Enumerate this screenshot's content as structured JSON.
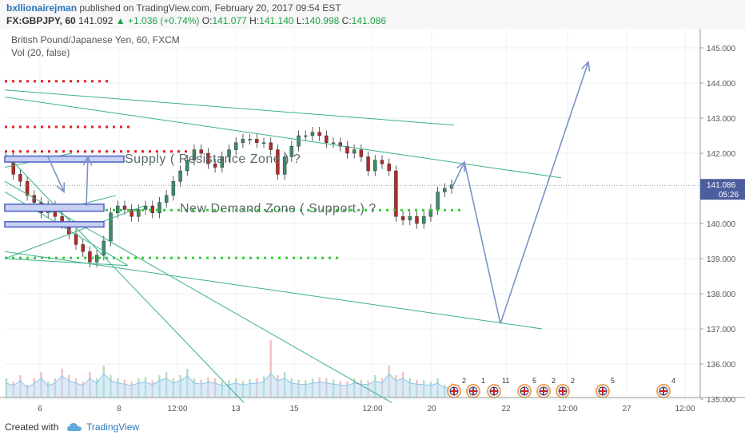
{
  "header": {
    "author": "bxllionairejman",
    "published_text": "published on TradingView.com, February 20, 2017 09:54 EST",
    "symbol": "FX:GBPJPY, 60",
    "last_price": "141.092",
    "change": "+1.036 (+0.74%)",
    "o_label": "O:",
    "o_value": "141.077",
    "h_label": "H:",
    "h_value": "141.140",
    "l_label": "L:",
    "l_value": "140.998",
    "c_label": "C:",
    "c_value": "141.086"
  },
  "footer": {
    "created_with": "Created with",
    "brand": "TradingView"
  },
  "colors": {
    "up_candle": "#3d8a6a",
    "down_candle": "#b22a2a",
    "trendline": "#3cb08a",
    "resistance_dots": "#e02020",
    "support_dots": "#33cc33",
    "arrow": "#7b93c4",
    "zone_fill": "#c8d1f2",
    "zone_border": "#4a5fc4",
    "price_tag": "#4d5e9e"
  },
  "chart_data": {
    "type": "candlestick",
    "title": "British Pound/Japanese Yen, 60, FXCM",
    "indicator": "Vol (20, false)",
    "x_ticks": [
      "6",
      "8",
      "12:00",
      "13",
      "15",
      "12:00",
      "20",
      "22",
      "12:00",
      "27",
      "12:00"
    ],
    "y_ticks": [
      "145.000",
      "144.000",
      "143.000",
      "142.000",
      "141.000",
      "140.000",
      "139.000",
      "138.000",
      "137.000",
      "136.000",
      "135.000"
    ],
    "ylim": [
      134.9,
      146.0
    ],
    "last_price": "141.086",
    "countdown": "05:26",
    "price_path": [
      141.9,
      141.4,
      141.2,
      140.8,
      140.6,
      140.3,
      140.5,
      140.2,
      140.0,
      139.7,
      139.4,
      139.2,
      138.9,
      139.1,
      139.5,
      140.3,
      140.5,
      140.4,
      140.2,
      140.4,
      140.5,
      140.3,
      140.6,
      140.8,
      141.2,
      141.5,
      141.8,
      142.1,
      142.0,
      141.7,
      141.6,
      141.9,
      142.1,
      142.3,
      142.4,
      142.4,
      142.3,
      142.3,
      142.1,
      141.4,
      141.9,
      142.2,
      142.5,
      142.5,
      142.6,
      142.5,
      142.3,
      142.3,
      142.2,
      142.0,
      142.1,
      141.9,
      141.5,
      141.8,
      141.7,
      141.5,
      140.2,
      140.1,
      140.2,
      140.0,
      140.2,
      140.4,
      140.9,
      141.0,
      141.1
    ],
    "volume_path": [
      0.3,
      0.25,
      0.35,
      0.2,
      0.3,
      0.4,
      0.25,
      0.3,
      0.45,
      0.35,
      0.3,
      0.25,
      0.4,
      0.3,
      0.5,
      0.35,
      0.3,
      0.28,
      0.25,
      0.3,
      0.32,
      0.27,
      0.35,
      0.4,
      0.3,
      0.35,
      0.45,
      0.3,
      0.28,
      0.32,
      0.3,
      0.25,
      0.27,
      0.3,
      0.26,
      0.29,
      0.3,
      0.33,
      0.9,
      0.35,
      0.4,
      0.3,
      0.28,
      0.27,
      0.3,
      0.32,
      0.3,
      0.28,
      0.26,
      0.25,
      0.3,
      0.28,
      0.27,
      0.35,
      0.3,
      0.5,
      0.35,
      0.4,
      0.3,
      0.28,
      0.27,
      0.25,
      0.3,
      0.2,
      0.22
    ],
    "annotations": [
      {
        "text": "Supply ( Resistance Zone ) ?"
      },
      {
        "text": "New Demand Zone ( Support ) ?"
      }
    ],
    "event_numbers": [
      "2",
      "1",
      "11",
      "5",
      "2",
      "2",
      "5",
      "4"
    ]
  }
}
